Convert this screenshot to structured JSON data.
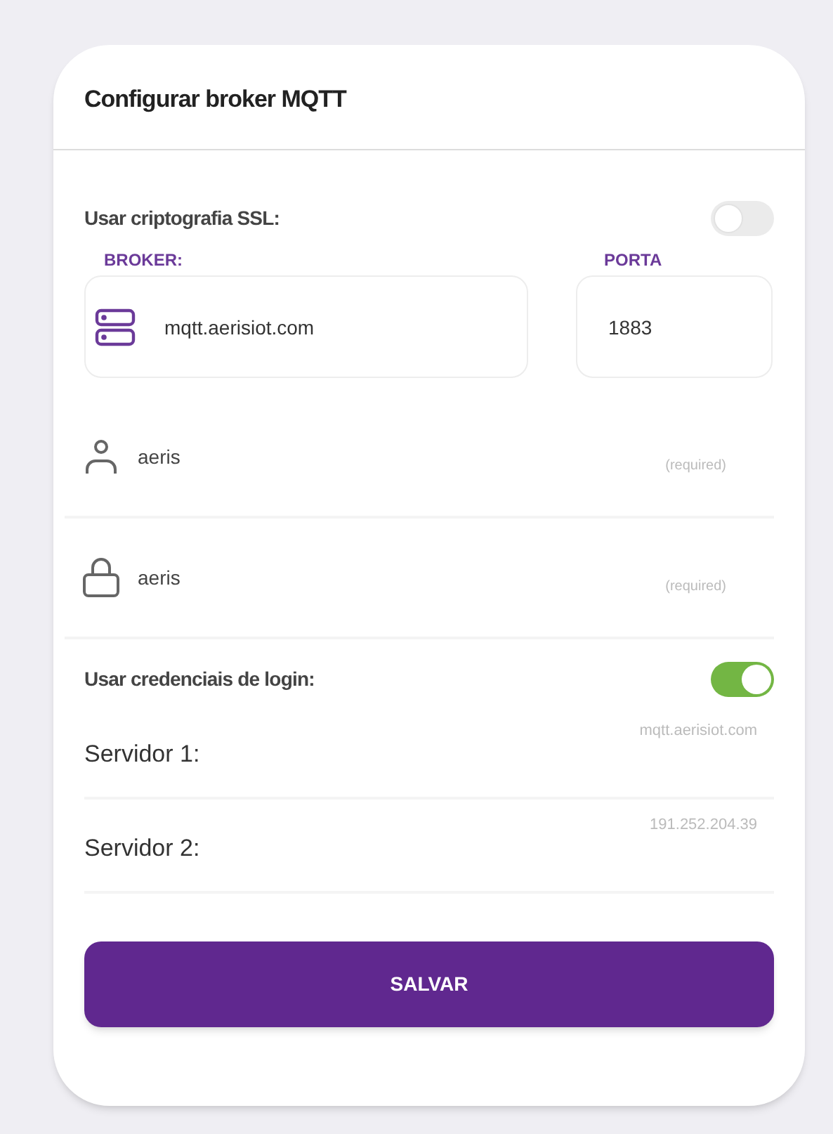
{
  "header": {
    "title": "Configurar broker MQTT"
  },
  "ssl": {
    "label": "Usar criptografia SSL:",
    "on": false
  },
  "broker": {
    "label": "BROKER:",
    "value": "mqtt.aerisiot.com"
  },
  "port": {
    "label": "PORTA",
    "value": "1883"
  },
  "credentials": [
    {
      "kind": "user",
      "value": "aeris",
      "hint": "(required)"
    },
    {
      "kind": "password",
      "value": "aeris",
      "hint": "(required)"
    }
  ],
  "login": {
    "label": "Usar credenciais de login:",
    "on": true
  },
  "servers": [
    {
      "label": "Servidor 1:",
      "placeholder": "mqtt.aerisiot.com"
    },
    {
      "label": "Servidor 2:",
      "placeholder": "191.252.204.39"
    }
  ],
  "button": "SALVAR"
}
